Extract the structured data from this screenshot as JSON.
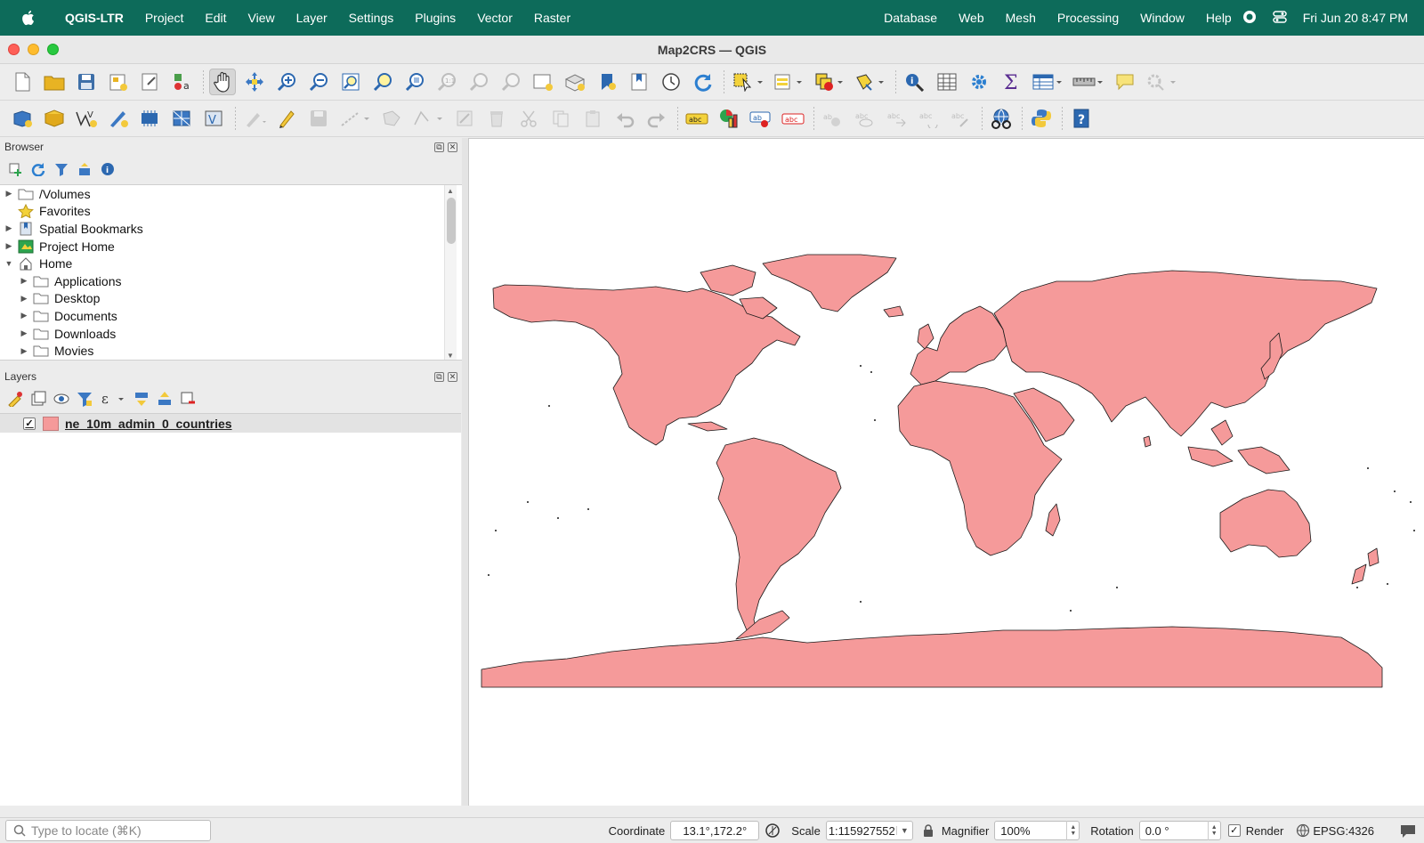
{
  "menubar": {
    "app_name": "QGIS-LTR",
    "items": [
      "Project",
      "Edit",
      "View",
      "Layer",
      "Settings",
      "Plugins",
      "Vector",
      "Raster"
    ],
    "right_items": [
      "Database",
      "Web",
      "Mesh",
      "Processing",
      "Window",
      "Help"
    ],
    "clock": "Fri Jun 20  8:47 PM"
  },
  "window": {
    "title": "Map2CRS — QGIS"
  },
  "browser": {
    "title": "Browser",
    "items": [
      {
        "label": "/Volumes",
        "icon": "folder-icon",
        "expander": "▶",
        "level": 0
      },
      {
        "label": "Favorites",
        "icon": "star-icon",
        "expander": "",
        "level": 0
      },
      {
        "label": "Spatial Bookmarks",
        "icon": "bookmark-icon",
        "expander": "▶",
        "level": 0
      },
      {
        "label": "Project Home",
        "icon": "project-home-icon",
        "expander": "▶",
        "level": 0
      },
      {
        "label": "Home",
        "icon": "home-icon",
        "expander": "▼",
        "level": 0
      },
      {
        "label": "Applications",
        "icon": "folder-icon",
        "expander": "▶",
        "level": 1
      },
      {
        "label": "Desktop",
        "icon": "folder-icon",
        "expander": "▶",
        "level": 1
      },
      {
        "label": "Documents",
        "icon": "folder-icon",
        "expander": "▶",
        "level": 1
      },
      {
        "label": "Downloads",
        "icon": "folder-icon",
        "expander": "▶",
        "level": 1
      },
      {
        "label": "Movies",
        "icon": "folder-icon",
        "expander": "▶",
        "level": 1
      }
    ]
  },
  "layers": {
    "title": "Layers",
    "items": [
      {
        "name": "ne_10m_admin_0_countries",
        "checked": "✓",
        "color": "#f59a9a"
      }
    ]
  },
  "map": {
    "land_color": "#f59a9a",
    "border_color": "#1a1a1a"
  },
  "statusbar": {
    "locator_placeholder": "Type to locate (⌘K)",
    "coordinate_label": "Coordinate",
    "coordinate_value": "13.1°,172.2°",
    "scale_label": "Scale",
    "scale_value": "1:115927552",
    "magnifier_label": "Magnifier",
    "magnifier_value": "100%",
    "rotation_label": "Rotation",
    "rotation_value": "0.0 °",
    "render_label": "Render",
    "render_checked": "✓",
    "crs": "EPSG:4326"
  }
}
